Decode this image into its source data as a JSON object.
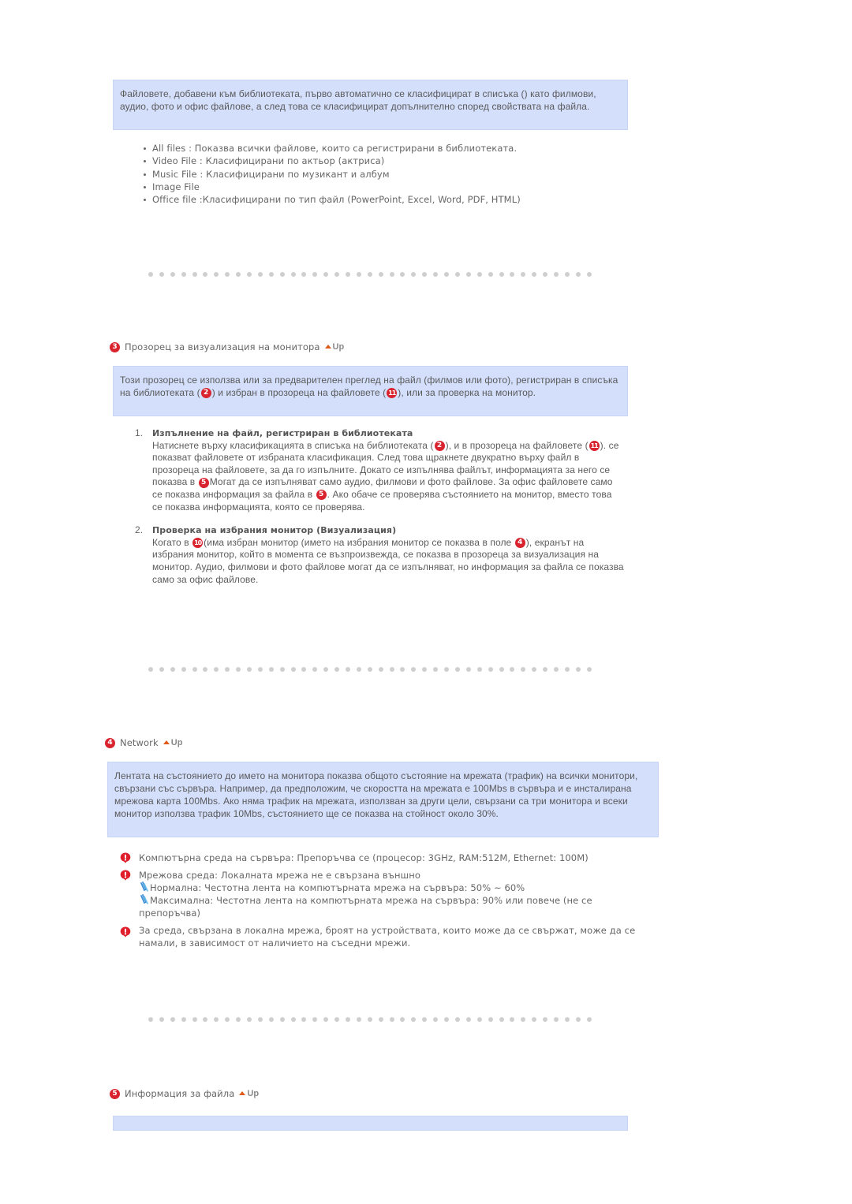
{
  "intro_note": "Файловете, добавени към библиотеката, първо автоматично се класифицират в списъка () като филмови, аудио, фото и офис файлове, а след това се класифицират допълнително според свойствата на файла.",
  "file_types": [
    "All files : Показва всички файлове, които са регистрирани в библиотеката.",
    "Video File : Класифицирани по актьор (актриса)",
    "Music File : Класифицирани по музикант и албум",
    "Image File",
    "Office file :Класифицирани по тип файл (PowerPoint, Excel, Word, PDF, HTML)"
  ],
  "up_label": "Up",
  "sections": {
    "monitor_view": {
      "number": "3",
      "title": "Прозорец за визуализация на монитора",
      "note": {
        "part1": "Този прозорец се използва или за предварителен преглед на файл (филмов или фото), регистриран в списъка на библиотеката (",
        "badge1": "2",
        "part2": ") и избран в прозореца на файловете (",
        "badge2": "11",
        "part3": "), или за проверка на монитор."
      },
      "items": [
        {
          "num": "1.",
          "title": "Изпълнение на файл, регистриран в библиотеката",
          "t1": "Натиснете върху класификацията в списъка на библиотеката (",
          "b1": "2",
          "t2": "), и в прозореца на файловете (",
          "b2": "11",
          "t3": "). се показват файловете от избраната класификация. След това щракнете двукратно върху файл в прозореца на файловете, за да го изпълните. Докато се изпълнява файлът, информацията за него се показва в ",
          "b3": "5",
          "t4": "Могат да се изпълняват само аудио, филмови и фото файлове. За офис файловете само се показва информация за файла в ",
          "b4": "5",
          "t5": ". Ако обаче се проверява състоянието на монитор, вместо това се показва информацията, която се проверява."
        },
        {
          "num": "2.",
          "title": "Проверка на избрания монитор (Визуализация)",
          "t1": "Когато в ",
          "b1": "10",
          "t2": "(има избран монитор (името на избрания монитор се показва в поле ",
          "b2": "4",
          "t3": "), екранът на избрания монитор, който в момента се възпроизвежда, се показва в прозореца за визуализация на монитор. Аудио, филмови и фото файлове могат да се изпълняват, но информация за файла се показва само за офис файлове."
        }
      ]
    },
    "network": {
      "number": "4",
      "title": "Network",
      "note": "Лентата на състоянието до името на монитора показва общото състояние на мрежата (трафик) на всички монитори, свързани със сървъра. Например, да предположим, че скоростта на мрежата е 100Mbs в сървъра и е инсталирана мрежова карта 100Mbs. Ако няма трафик на мрежата, използван за други цели, свързани са три монитора и всеки монитор използва трафик 10Mbs, състоянието ще се показва на стойност около 30%.",
      "warnings": [
        {
          "text": "Компютърна среда на сървъра: Препоръчва се (процесор: 3GHz, RAM:512M, Ethernet: 100M)"
        },
        {
          "text": "Мрежова среда: Локалната мрежа не е свързана външно",
          "sub": [
            "Нормална: Честотна лента на компютърната мрежа на сървъра: 50% ~ 60%",
            "Максимална: Честотна лента на компютърната мрежа на сървъра: 90% или повече (не се препоръчва)"
          ]
        },
        {
          "text": "За среда, свързана в локална мрежа, броят на устройствата, които може да се свържат, може да се намали, в зависимост от наличието на съседни мрежи."
        }
      ]
    },
    "file_info": {
      "number": "5",
      "title": "Информация за файла",
      "note": ""
    }
  },
  "colors": {
    "note_bg": "#d4dffc",
    "badge_red": "#d9232e",
    "up_arrow": "#e05a1a",
    "dot_gray": "#cfcfcf"
  }
}
